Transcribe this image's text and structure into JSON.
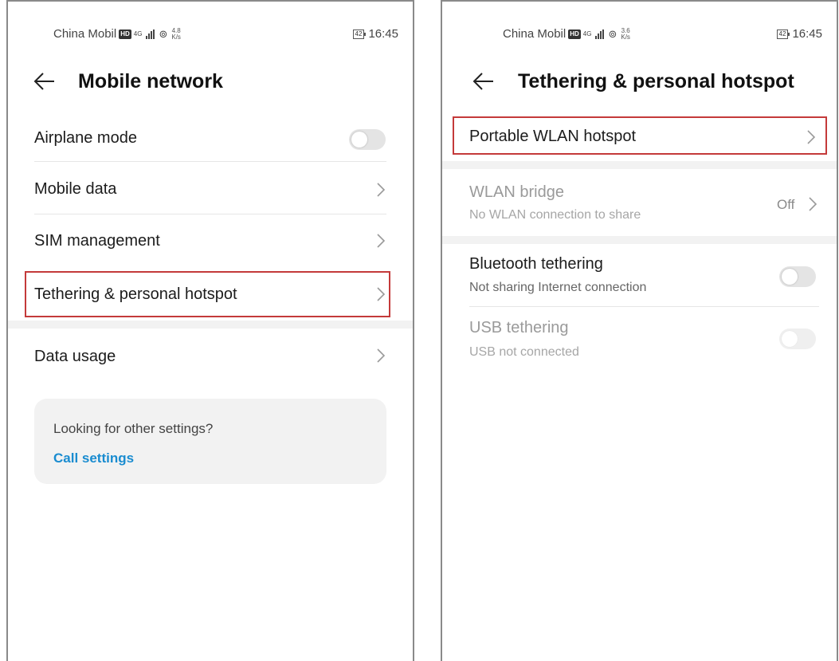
{
  "left_screen": {
    "status_bar": {
      "carrier": "China Mobil",
      "hd": "HD",
      "net": "4G",
      "speed_top": "4.8",
      "speed_bottom": "K/s",
      "battery": "42",
      "time": "16:45"
    },
    "title": "Mobile network",
    "rows": {
      "airplane_mode": "Airplane mode",
      "mobile_data": "Mobile data",
      "sim_management": "SIM management",
      "tethering": "Tethering & personal hotspot",
      "data_usage": "Data usage"
    },
    "card": {
      "title": "Looking for other settings?",
      "link": "Call settings"
    }
  },
  "right_screen": {
    "status_bar": {
      "carrier": "China Mobil",
      "hd": "HD",
      "net": "4G",
      "speed_top": "3.6",
      "speed_bottom": "K/s",
      "battery": "42",
      "time": "16:45"
    },
    "title": "Tethering & personal hotspot",
    "rows": {
      "portable_wlan": "Portable WLAN hotspot",
      "wlan_bridge": {
        "label": "WLAN bridge",
        "sub": "No WLAN connection to share",
        "value": "Off"
      },
      "bluetooth": {
        "label": "Bluetooth tethering",
        "sub": "Not sharing Internet connection"
      },
      "usb": {
        "label": "USB tethering",
        "sub": "USB not connected"
      }
    }
  },
  "colors": {
    "highlight": "#c43a3a",
    "link": "#1a8cd0",
    "card_bg": "#f2f2f2",
    "toggle_off": "#e4e4e4"
  },
  "icons": [
    "back-arrow-icon",
    "chevron-right-icon",
    "hotspot-icon",
    "signal-icon",
    "battery-icon"
  ]
}
